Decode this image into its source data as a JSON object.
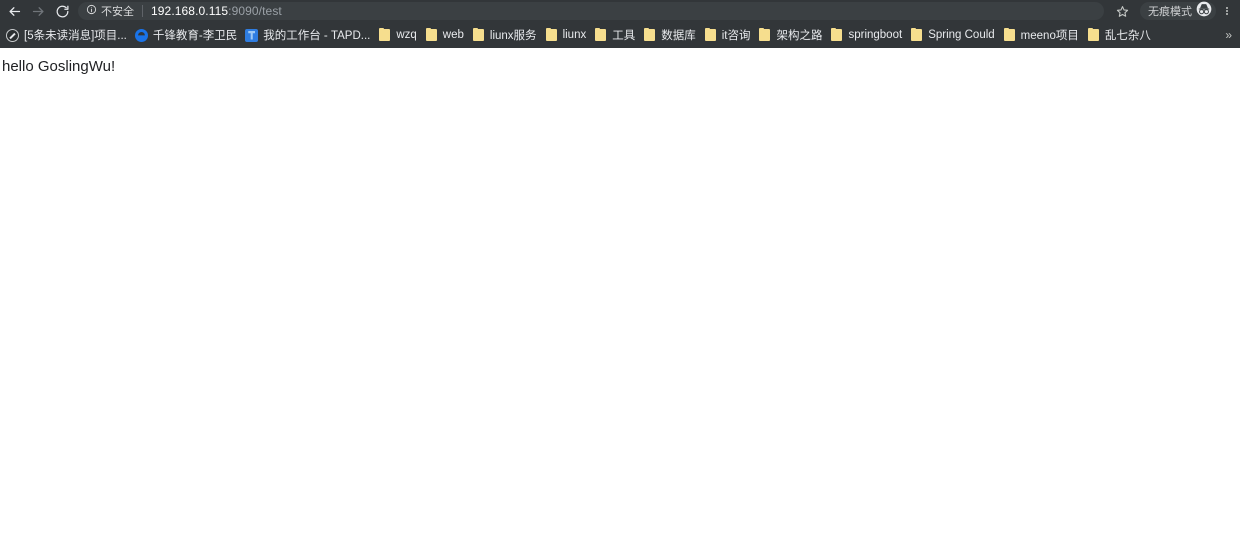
{
  "browser": {
    "nav": {
      "back_icon": "arrow-left-icon",
      "forward_icon": "arrow-right-icon",
      "reload_icon": "reload-icon"
    },
    "omnibox": {
      "security_icon": "info-circle-icon",
      "security_label": "不安全",
      "url_host": "192.168.0.115",
      "url_rest": ":9090/test",
      "url_full": "192.168.0.115:9090/test"
    },
    "toolbar_right": {
      "bookmark_star_icon": "star-icon",
      "incognito_label": "无痕模式",
      "incognito_icon": "incognito-hat-glasses-icon",
      "menu_icon": "three-dot-menu-icon"
    },
    "bookmarks": {
      "overflow_label": "»",
      "items": [
        {
          "label": "[5条未读消息]项目...",
          "icon": "dark-circle-slash-favicon",
          "icon_type": "dark"
        },
        {
          "label": "千锋教育-李卫民",
          "icon": "blue-round-favicon",
          "icon_type": "blue-round"
        },
        {
          "label": "我的工作台 - TAPD...",
          "icon": "tapd-blue-square-favicon",
          "icon_type": "blue-square"
        },
        {
          "label": "wzq",
          "icon": "folder-icon",
          "icon_type": "folder"
        },
        {
          "label": "web",
          "icon": "folder-icon",
          "icon_type": "folder"
        },
        {
          "label": "liunx服务",
          "icon": "folder-icon",
          "icon_type": "folder"
        },
        {
          "label": "liunx",
          "icon": "folder-icon",
          "icon_type": "folder"
        },
        {
          "label": "工具",
          "icon": "folder-icon",
          "icon_type": "folder"
        },
        {
          "label": "数据库",
          "icon": "folder-icon",
          "icon_type": "folder"
        },
        {
          "label": "it咨询",
          "icon": "folder-icon",
          "icon_type": "folder"
        },
        {
          "label": "架构之路",
          "icon": "folder-icon",
          "icon_type": "folder"
        },
        {
          "label": "springboot",
          "icon": "folder-icon",
          "icon_type": "folder"
        },
        {
          "label": "Spring Could",
          "icon": "folder-icon",
          "icon_type": "folder"
        },
        {
          "label": "meeno项目",
          "icon": "folder-icon",
          "icon_type": "folder"
        },
        {
          "label": "乱七杂八",
          "icon": "folder-icon",
          "icon_type": "folder"
        }
      ]
    }
  },
  "page": {
    "body_text": "hello GoslingWu!"
  },
  "colors": {
    "chrome_background": "#323639",
    "omnibox_background": "#3b4043",
    "text_primary": "#e8eaed",
    "text_secondary": "#9aa0a6",
    "folder_yellow": "#f6de8e",
    "page_background": "#ffffff",
    "page_text": "#202124"
  }
}
